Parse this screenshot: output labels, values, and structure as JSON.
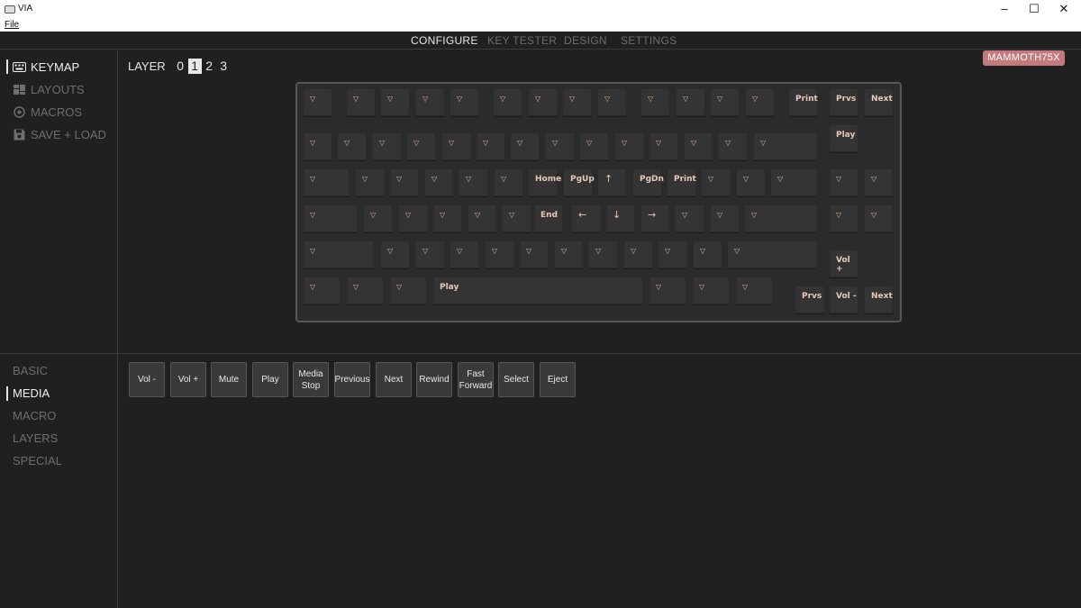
{
  "window": {
    "title": "VIA",
    "minimize": "–",
    "maximize": "☐",
    "close": "✕"
  },
  "menu": {
    "file": "File"
  },
  "topnav": [
    {
      "label": "CONFIGURE",
      "active": true
    },
    {
      "label": "KEY TESTER",
      "active": false
    },
    {
      "label": "DESIGN",
      "active": false
    },
    {
      "label": "SETTINGS",
      "active": false
    }
  ],
  "sidebar": [
    {
      "label": "KEYMAP",
      "icon": "keyboard-icon",
      "active": true
    },
    {
      "label": "LAYOUTS",
      "icon": "layouts-icon",
      "active": false
    },
    {
      "label": "MACROS",
      "icon": "macros-icon",
      "active": false
    },
    {
      "label": "SAVE + LOAD",
      "icon": "save-icon",
      "active": false
    }
  ],
  "layer": {
    "label": "LAYER",
    "options": [
      "0",
      "1",
      "2",
      "3"
    ],
    "selected": "1"
  },
  "device": {
    "name": "MAMMOTH75X",
    "color": "#c47a7d"
  },
  "keymap_legends": {
    "transparent": "▽",
    "row0": [
      "▽",
      "▽",
      "▽",
      "▽",
      "▽",
      "▽",
      "▽",
      "▽",
      "▽",
      "▽",
      "▽",
      "▽",
      "▽",
      "Print",
      "Prvs",
      "Next"
    ],
    "row1": [
      "▽",
      "▽",
      "▽",
      "▽",
      "▽",
      "▽",
      "▽",
      "▽",
      "▽",
      "▽",
      "▽",
      "▽",
      "▽",
      "▽",
      "Play"
    ],
    "row2": [
      "▽",
      "▽",
      "▽",
      "▽",
      "▽",
      "▽",
      "Home",
      "PgUp",
      "↑",
      "PgDn",
      "Print",
      "▽",
      "▽",
      "▽",
      "▽",
      "▽"
    ],
    "row3": [
      "▽",
      "▽",
      "▽",
      "▽",
      "▽",
      "▽",
      "End",
      "←",
      "↓",
      "→",
      "▽",
      "▽",
      "▽",
      "▽",
      "▽"
    ],
    "row4": [
      "▽",
      "▽",
      "▽",
      "▽",
      "▽",
      "▽",
      "▽",
      "▽",
      "▽",
      "▽",
      "▽",
      "▽",
      "▽",
      "Vol +"
    ],
    "row5": [
      "▽",
      "▽",
      "▽",
      "Play",
      "▽",
      "▽",
      "▽",
      "Prvs",
      "Vol -",
      "Next"
    ]
  },
  "categories": [
    {
      "label": "BASIC",
      "active": false
    },
    {
      "label": "MEDIA",
      "active": true
    },
    {
      "label": "MACRO",
      "active": false
    },
    {
      "label": "LAYERS",
      "active": false
    },
    {
      "label": "SPECIAL",
      "active": false
    }
  ],
  "media_keys": [
    "Vol -",
    "Vol +",
    "Mute",
    "Play",
    "Media Stop",
    "Previous",
    "Next",
    "Rewind",
    "Fast Forward",
    "Select",
    "Eject"
  ]
}
